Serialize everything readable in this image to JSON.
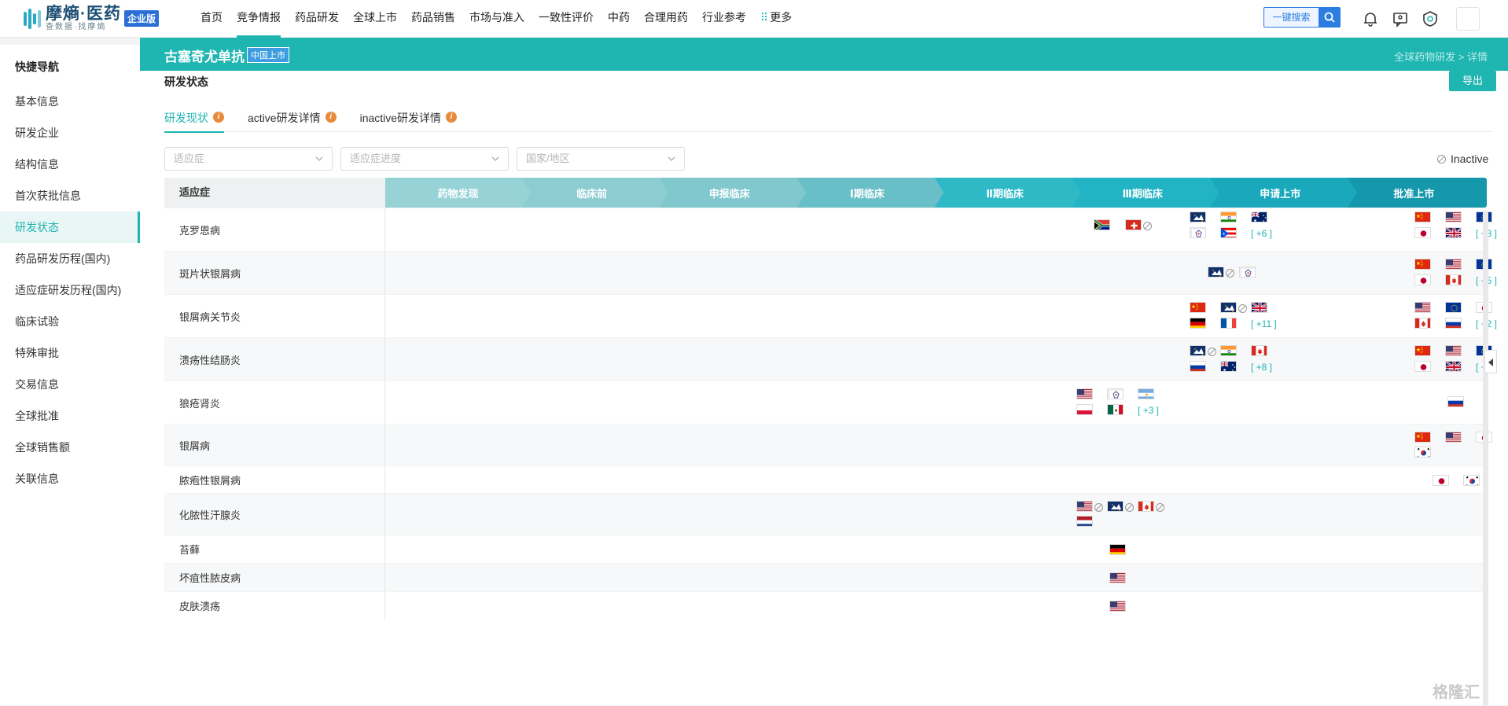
{
  "app": {
    "logo_title": "摩熵·医药",
    "logo_subtitle": "查数据·找摩熵",
    "edition": "企业版"
  },
  "nav": [
    "首页",
    "竞争情报",
    "药品研发",
    "全球上市",
    "药品销售",
    "市场与准入",
    "一致性评价",
    "中药",
    "合理用药",
    "行业参考",
    "更多"
  ],
  "search": {
    "label": "一键搜索"
  },
  "sidebar": {
    "title": "快捷导航",
    "items": [
      "基本信息",
      "研发企业",
      "结构信息",
      "首次获批信息",
      "研发状态",
      "药品研发历程(国内)",
      "适应症研发历程(国内)",
      "临床试验",
      "特殊审批",
      "交易信息",
      "全球批准",
      "全球销售额",
      "关联信息"
    ]
  },
  "header": {
    "drug_name": "古塞奇尤单抗",
    "tag": "中国上市",
    "breadcrumb": "全球药物研发 > 详情"
  },
  "section_title": "研发状态",
  "export_label": "导出",
  "tabs": [
    "研发现状",
    "active研发详情",
    "inactive研发详情"
  ],
  "filters": {
    "indication": "适应症",
    "progress": "适应症进度",
    "country": "国家/地区"
  },
  "legend_inactive": "Inactive",
  "table": {
    "first_header": "适应症",
    "phases": [
      "药物发现",
      "临床前",
      "申报临床",
      "Ⅰ期临床",
      "Ⅱ期临床",
      "Ⅲ期临床",
      "申请上市",
      "批准上市"
    ],
    "rows": [
      {
        "name": "克罗恩病",
        "phase2_more": "",
        "phase3_more": "[ +6 ]",
        "approved_more": "[ +3 ]"
      },
      {
        "name": "斑片状银屑病",
        "phase3_more": "",
        "approved_more": "[ +5 ]"
      },
      {
        "name": "银屑病关节炎",
        "phase3_more": "[ +11 ]",
        "approved_more": "[ +2 ]"
      },
      {
        "name": "溃疡性结肠炎",
        "phase3_more": "[ +8 ]",
        "approved_more": "[ +2 ]"
      },
      {
        "name": "狼疮肾炎",
        "phase2_more": "[ +3 ]"
      },
      {
        "name": "银屑病"
      },
      {
        "name": "脓疱性银屑病"
      },
      {
        "name": "化脓性汗腺炎"
      },
      {
        "name": "苔藓"
      },
      {
        "name": "坏疽性脓皮病"
      },
      {
        "name": "皮肤溃疡"
      }
    ]
  },
  "watermark": "格隆汇"
}
